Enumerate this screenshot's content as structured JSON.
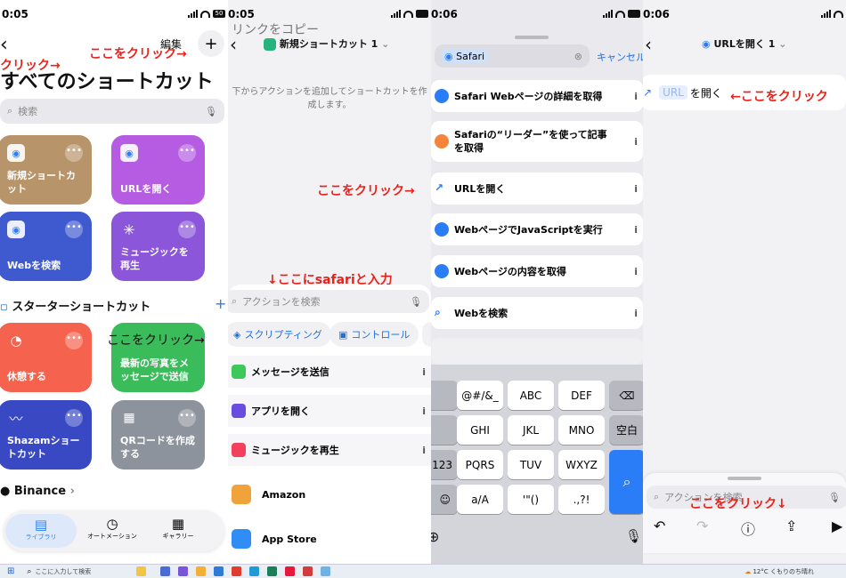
{
  "panel1": {
    "time": "0:05",
    "battery": "50",
    "back_icon": "chevron-left",
    "edit_label": "編集",
    "title": "すべてのショートカット",
    "search_placeholder": "検索",
    "tiles": [
      {
        "label": "新規ショートカット",
        "color": "#b8946a"
      },
      {
        "label": "URLを開く",
        "color": "#b55ce3"
      },
      {
        "label": "Webを検索",
        "color": "#3f59cf"
      },
      {
        "label": "ミュージックを再生",
        "color": "#8b56d9"
      }
    ],
    "starter_title": "スターターショートカット",
    "starter_tiles": [
      {
        "label": "休憩する",
        "color": "#f5624d"
      },
      {
        "label": "最新の写真をメッセージで送信",
        "color": "#3bbc5b"
      },
      {
        "label": "Shazamショートカット",
        "color": "#3949c4"
      },
      {
        "label": "QRコードを作成する",
        "color": "#8d939c"
      }
    ],
    "binance_label": "Binance",
    "tabs": [
      {
        "label": "ライブラリ",
        "icon": "library-icon"
      },
      {
        "label": "オートメーション",
        "icon": "clock-icon"
      },
      {
        "label": "ギャラリー",
        "icon": "grid-icon"
      }
    ],
    "annotations": {
      "click_top": "ここをクリック→",
      "click_left": "クリック→",
      "click_mid": "ここをクリック→"
    }
  },
  "panel2": {
    "time": "0:05",
    "overlay_text": "リンクをコピー",
    "shortcut_name": "新規ショートカット 1",
    "empty_hint": "下からアクションを追加してショートカットを作成します。",
    "search_placeholder": "アクションを検索",
    "chips": [
      "スクリプティング",
      "コントロール"
    ],
    "actions": [
      {
        "label": "メッセージを送信",
        "color": "#3cc85b"
      },
      {
        "label": "アプリを開く",
        "color": "#6a4de0"
      },
      {
        "label": "ミュージックを再生",
        "color": "#f3405d"
      }
    ],
    "apps": [
      {
        "label": "Amazon"
      },
      {
        "label": "App Store"
      }
    ],
    "annotations": {
      "click": "ここをクリック→",
      "input_hint": "↓ここにsafariと入力"
    }
  },
  "panel3": {
    "time": "0:06",
    "search_value": "Safari",
    "cancel_label": "キャンセル",
    "results": [
      "Safari Webページの詳細を取得",
      "Safariの“リーダー”を使って記事を取得",
      "URLを開く",
      "WebページでJavaScriptを実行",
      "Webページの内容を取得",
      "Webを検索"
    ],
    "keyboard": {
      "row1": [
        "@#/&_",
        "ABC",
        "DEF"
      ],
      "row2": [
        "GHI",
        "JKL",
        "MNO"
      ],
      "row3": [
        "PQRS",
        "TUV",
        "WXYZ"
      ],
      "row4": [
        "a/A",
        "'\"()",
        ".,?!"
      ],
      "space_label": "空白",
      "num_label": "123"
    }
  },
  "panel4": {
    "time": "0:06",
    "shortcut_name": "URLを開く 1",
    "action_url_token": "URL",
    "action_text": "を開く",
    "search_placeholder": "アクションを検索",
    "annotations": {
      "click_right": "←ここをクリック",
      "click_down": "ここをクリック↓"
    }
  },
  "taskbar": {
    "search_placeholder": "ここに入力して検索",
    "weather": "12°C くもりのち晴れ"
  }
}
